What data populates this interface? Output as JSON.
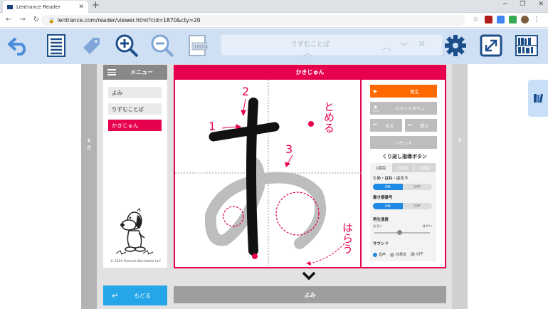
{
  "browser": {
    "tab_title": "Lentrance Reader",
    "url": "lentrance.com/reader/viewer.html?cid=1870&cty=20"
  },
  "toolbar": {
    "search_placeholder": "りずむことば"
  },
  "nav": {
    "prev_label": "次"
  },
  "menu": {
    "title": "メニュー",
    "items": [
      {
        "label": "よみ",
        "active": false
      },
      {
        "label": "りずむことば",
        "active": false
      },
      {
        "label": "かきじゅん",
        "active": true
      }
    ],
    "copyright": "© 2020 Peanuts Worldwide LLC",
    "back_label": "もどる"
  },
  "main": {
    "title": "かきじゅん",
    "annotations": {
      "stroke1": "1",
      "stroke2": "2",
      "stroke3": "3",
      "tome": "とめる",
      "harau": "はらう"
    },
    "bottom_label": "よみ"
  },
  "controls": {
    "play": "再生",
    "count": "カウントダウン",
    "count_sub": "3/2/1",
    "back": "戻る",
    "forward": "進む",
    "reset": "リセット",
    "repeat_title": "くり返し指導ボタン",
    "tabs": [
      "1回目",
      "2回目",
      "3回目"
    ],
    "tome_label": "とめ・はね・はらう",
    "order_label": "書き順番号",
    "speed_label": "再生速度",
    "speed_slow": "おそい",
    "speed_fast": "はやい",
    "speed_level": 0.45,
    "on": "ON",
    "off": "OFF",
    "sound_label": "サウンド",
    "sound_options": [
      "音声",
      "効果音",
      "OFF"
    ]
  },
  "colors": {
    "accent": "#e7004c",
    "play": "#ff6a00",
    "blue": "#24a6e8"
  }
}
